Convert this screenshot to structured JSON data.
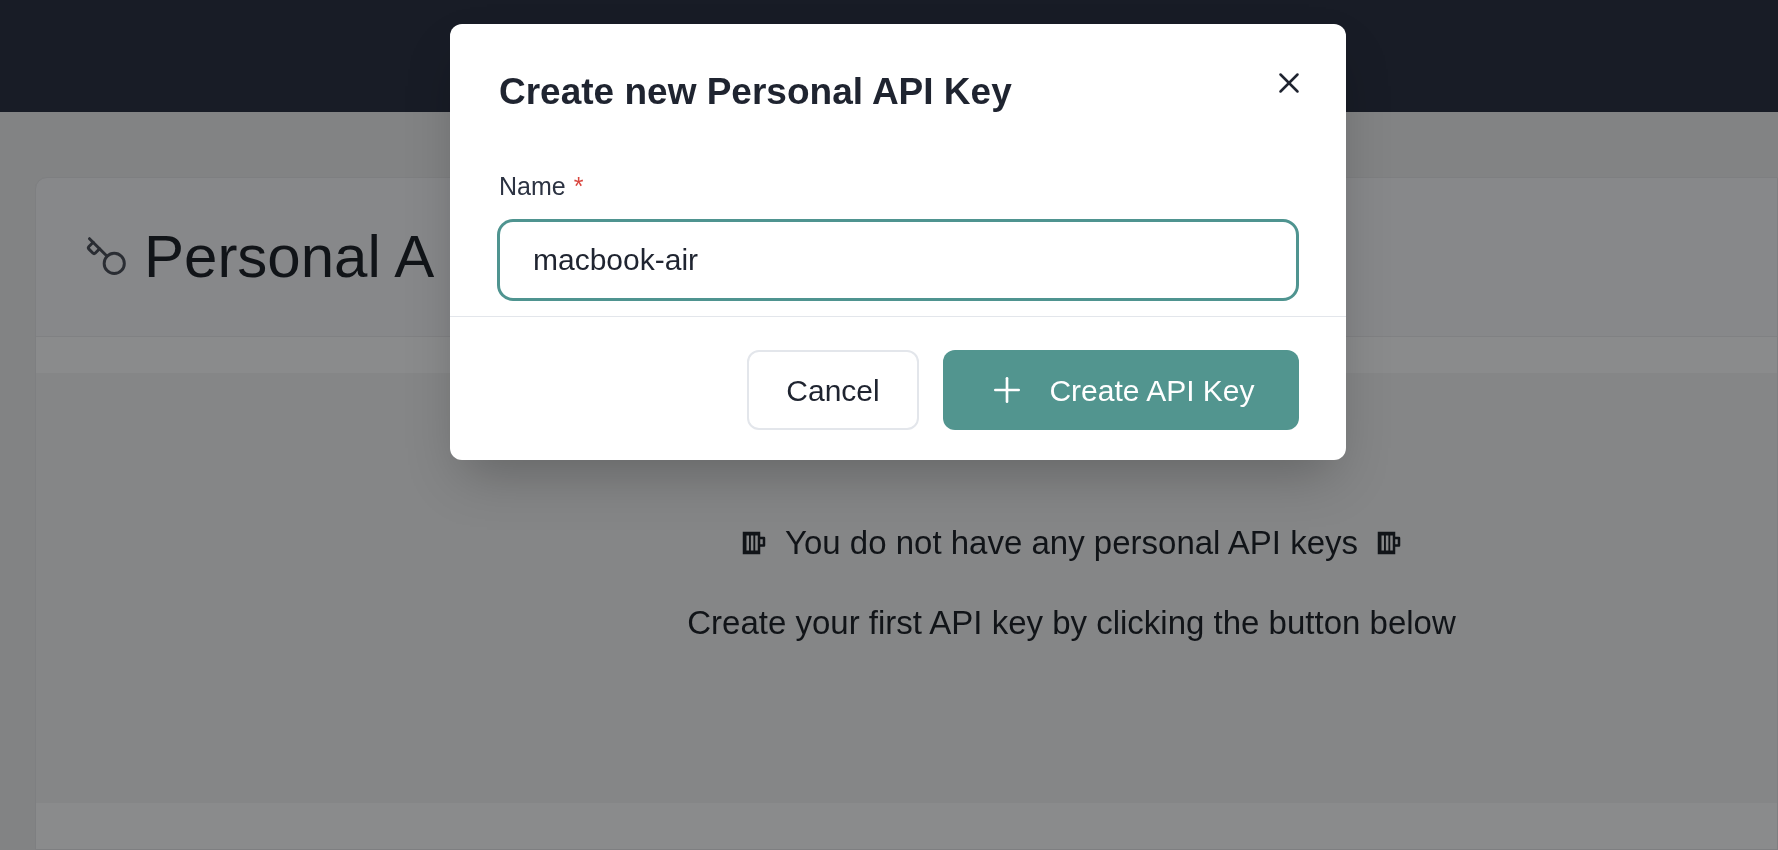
{
  "page": {
    "title": "Personal A"
  },
  "empty_state": {
    "title": "You do not have any personal API keys",
    "subtitle": "Create your first API key by clicking the button below"
  },
  "dialog": {
    "title": "Create new Personal API Key",
    "field": {
      "label": "Name",
      "required_mark": "*",
      "value": "macbook-air",
      "focused": true
    },
    "buttons": [
      {
        "kind": "secondary",
        "label": "Cancel"
      },
      {
        "kind": "primary",
        "label": "Create API Key"
      }
    ]
  }
}
